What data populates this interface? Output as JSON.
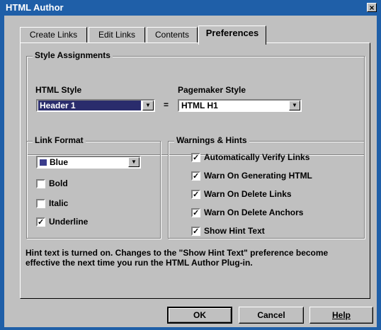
{
  "window": {
    "title": "HTML Author",
    "close_glyph": "×"
  },
  "tabs": [
    {
      "label": "Create Links",
      "active": false
    },
    {
      "label": "Edit Links",
      "active": false
    },
    {
      "label": "Contents",
      "active": false
    },
    {
      "label": "Preferences",
      "active": true
    }
  ],
  "style_assignments": {
    "title": "Style Assignments",
    "html_style_label": "HTML Style",
    "html_style_value": "Header 1",
    "equals": "=",
    "pagemaker_style_label": "Pagemaker Style",
    "pagemaker_style_value": "HTML H1"
  },
  "link_format": {
    "title": "Link Format",
    "color_value": "Blue",
    "options": [
      {
        "label": "Bold",
        "checked": false
      },
      {
        "label": "Italic",
        "checked": false
      },
      {
        "label": "Underline",
        "checked": true
      }
    ]
  },
  "warnings": {
    "title": "Warnings & Hints",
    "options": [
      {
        "label": "Automatically Verify Links",
        "checked": true
      },
      {
        "label": "Warn On Generating HTML",
        "checked": true
      },
      {
        "label": "Warn On Delete Links",
        "checked": true
      },
      {
        "label": "Warn On Delete Anchors",
        "checked": true
      },
      {
        "label": "Show Hint Text",
        "checked": true
      }
    ]
  },
  "hint": {
    "line1": "Hint text is turned on.  Changes to the \"Show Hint Text\" preference become",
    "line2": "effective the next time you run the HTML Author Plug-in."
  },
  "buttons": {
    "ok": "OK",
    "cancel": "Cancel",
    "help": "Help"
  },
  "colors": {
    "titlebar": "#1f5fa8",
    "face": "#c0c0c0",
    "selection": "#2a2c6c",
    "swatch_blue": "#3a3c8c"
  },
  "icons": {
    "check": "✓",
    "dropdown": "▼"
  }
}
